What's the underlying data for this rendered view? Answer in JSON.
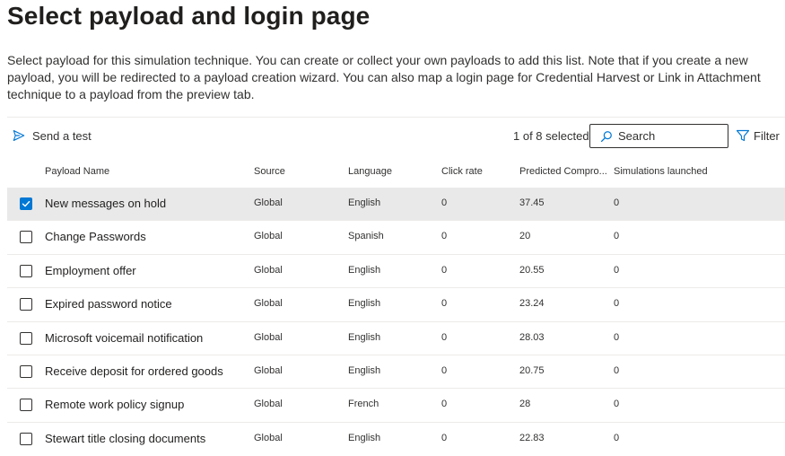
{
  "page": {
    "title": "Select payload and login page",
    "description": "Select payload for this simulation technique. You can create or collect your own payloads to add this list. Note that if you create a new payload, you will be redirected to a payload creation wizard. You can also map a login page for Credential Harvest or Link in Attachment technique to a payload from the preview tab."
  },
  "toolbar": {
    "send_test_label": "Send a test",
    "send_test_icon": "send-icon",
    "selected_count": "1 of 8 selected",
    "search_placeholder": "Search",
    "search_icon": "search-icon",
    "filter_label": "Filter",
    "filter_icon": "filter-icon"
  },
  "table": {
    "columns": [
      "Payload Name",
      "Source",
      "Language",
      "Click rate",
      "Predicted Compro...",
      "Simulations launched"
    ],
    "rows": [
      {
        "name": "New messages on hold",
        "source": "Global",
        "language": "English",
        "click_rate": "0",
        "predicted": "37.45",
        "simulations": "0",
        "selected": true
      },
      {
        "name": "Change Passwords",
        "source": "Global",
        "language": "Spanish",
        "click_rate": "0",
        "predicted": "20",
        "simulations": "0",
        "selected": false
      },
      {
        "name": "Employment offer",
        "source": "Global",
        "language": "English",
        "click_rate": "0",
        "predicted": "20.55",
        "simulations": "0",
        "selected": false
      },
      {
        "name": "Expired password notice",
        "source": "Global",
        "language": "English",
        "click_rate": "0",
        "predicted": "23.24",
        "simulations": "0",
        "selected": false
      },
      {
        "name": "Microsoft voicemail notification",
        "source": "Global",
        "language": "English",
        "click_rate": "0",
        "predicted": "28.03",
        "simulations": "0",
        "selected": false
      },
      {
        "name": "Receive deposit for ordered goods",
        "source": "Global",
        "language": "English",
        "click_rate": "0",
        "predicted": "20.75",
        "simulations": "0",
        "selected": false
      },
      {
        "name": "Remote work policy signup",
        "source": "Global",
        "language": "French",
        "click_rate": "0",
        "predicted": "28",
        "simulations": "0",
        "selected": false
      },
      {
        "name": "Stewart title closing documents",
        "source": "Global",
        "language": "English",
        "click_rate": "0",
        "predicted": "22.83",
        "simulations": "0",
        "selected": false
      }
    ]
  },
  "colors": {
    "accent": "#0078d4",
    "selected_row_bg": "#e9e9e9",
    "text": "#323130",
    "divider": "#edebe9"
  }
}
